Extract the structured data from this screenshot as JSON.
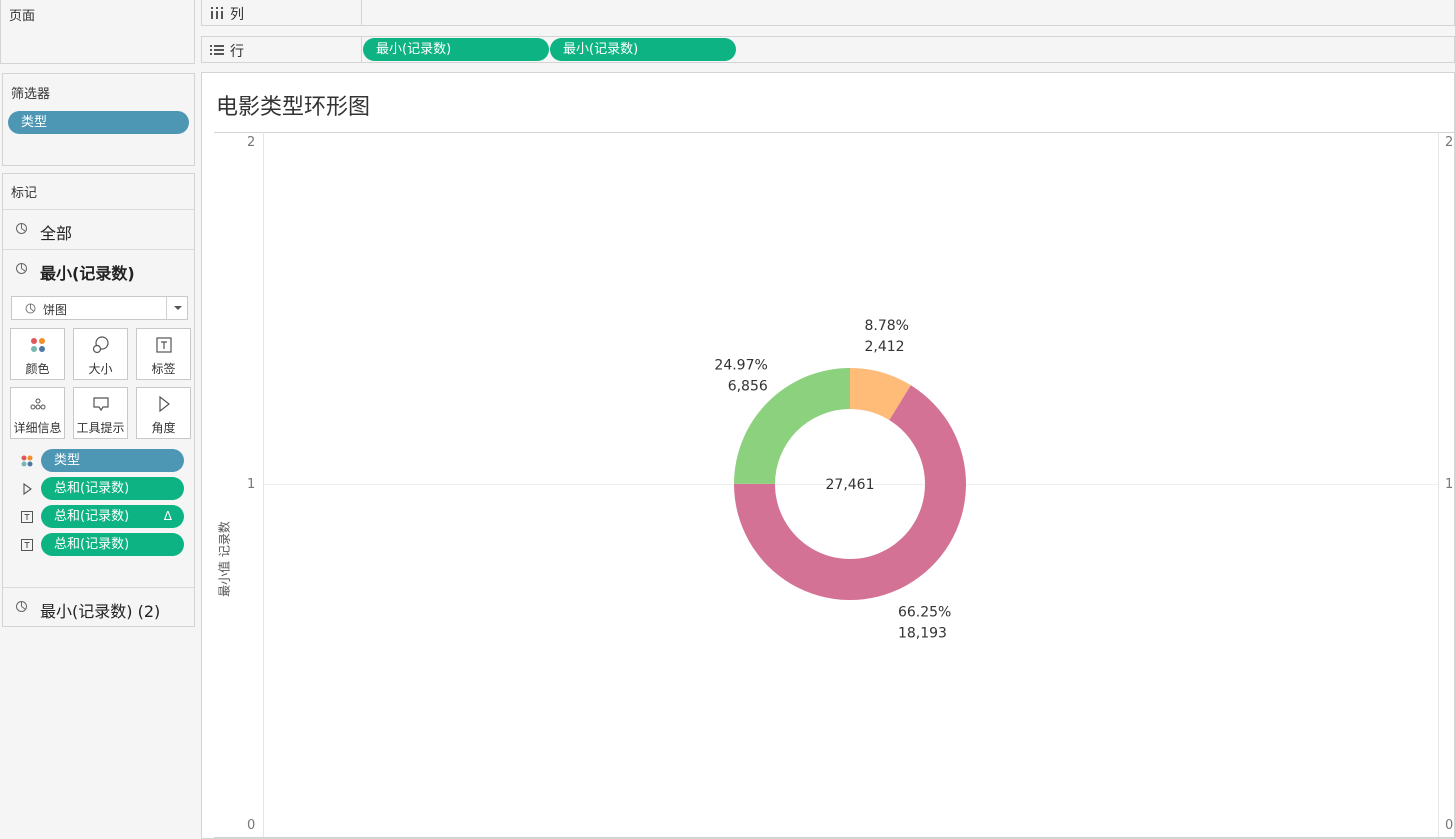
{
  "panels": {
    "pages": "页面",
    "filters": "筛选器",
    "marks": "标记"
  },
  "filters": {
    "items": [
      "类型"
    ]
  },
  "marks": {
    "rows": [
      "全部",
      "最小(记录数)",
      "最小(记录数) (2)"
    ],
    "mark_type": "饼图",
    "buttons": [
      "颜色",
      "大小",
      "标签",
      "详细信息",
      "工具提示",
      "角度"
    ],
    "fields": [
      {
        "label": "类型",
        "encoding": "color",
        "color": "#4d96b4"
      },
      {
        "label": "总和(记录数)",
        "encoding": "angle",
        "color": "#0db382"
      },
      {
        "label": "总和(记录数)",
        "encoding": "label",
        "color": "#0db382",
        "badge": "Δ"
      },
      {
        "label": "总和(记录数)",
        "encoding": "label",
        "color": "#0db382"
      }
    ]
  },
  "shelves": {
    "columns_label": "列",
    "rows_label": "行",
    "rows_pills": [
      "最小(记录数)",
      "最小(记录数)"
    ]
  },
  "view": {
    "title": "电影类型环形图",
    "ylabel": "最小值 记录数",
    "yticks_left": [
      "2",
      "1",
      "0"
    ],
    "yticks_right": [
      "2",
      "1",
      "0"
    ]
  },
  "chart_data": {
    "type": "pie",
    "subtype": "donut",
    "title": "电影类型环形图",
    "center_label": "27,461",
    "total": 27461,
    "ylabel": "最小值 记录数",
    "ylim": [
      0,
      2
    ],
    "grid": true,
    "slices": [
      {
        "value": 2412,
        "percent_label": "8.78%",
        "value_label": "2,412",
        "color": "#ffbb78"
      },
      {
        "value": 18193,
        "percent_label": "66.25%",
        "value_label": "18,193",
        "color": "#d37295"
      },
      {
        "value": 6856,
        "percent_label": "24.97%",
        "value_label": "6,856",
        "color": "#8cd17d"
      }
    ]
  }
}
